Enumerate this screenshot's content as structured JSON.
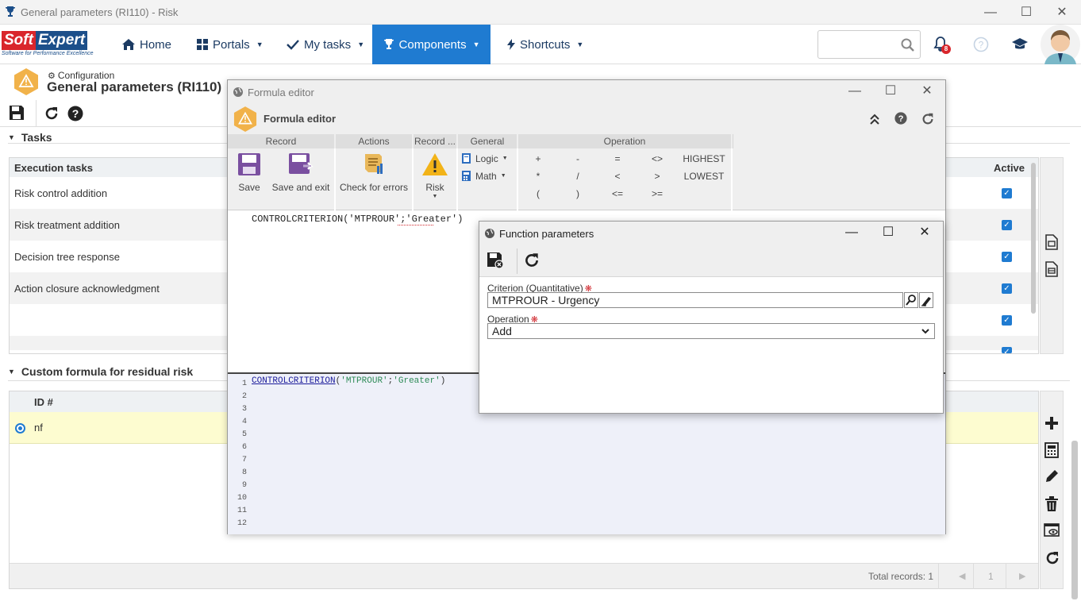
{
  "window": {
    "title": "General parameters (RI110) - Risk",
    "controls": [
      "minimize",
      "maximize",
      "close"
    ]
  },
  "brand": {
    "logo_text": "SoftExpert",
    "tagline": "Software for Performance Excellence"
  },
  "navbar": {
    "items": [
      {
        "label": "Home",
        "icon": "home-icon"
      },
      {
        "label": "Portals",
        "icon": "grid-icon",
        "dropdown": true
      },
      {
        "label": "My tasks",
        "icon": "check-icon",
        "dropdown": true
      },
      {
        "label": "Components",
        "icon": "trophy-icon",
        "dropdown": true,
        "active": true
      },
      {
        "label": "Shortcuts",
        "icon": "bolt-icon",
        "dropdown": true
      }
    ],
    "search_placeholder": "",
    "notifications_count": "8",
    "accent": "#1f7bd1"
  },
  "page": {
    "breadcrumb": "Configuration",
    "title": "General parameters (RI110)"
  },
  "tasks": {
    "section_title": "Tasks",
    "columns": [
      "Execution tasks",
      "Active"
    ],
    "rows": [
      {
        "name": "Risk control addition",
        "active": true
      },
      {
        "name": "Risk treatment addition",
        "active": true
      },
      {
        "name": "Decision tree response",
        "active": true
      },
      {
        "name": "Action closure acknowledgment",
        "active": true
      },
      {
        "name": "",
        "active": true
      },
      {
        "name": "",
        "active": true
      }
    ]
  },
  "custom_formula": {
    "section_title": "Custom formula for residual risk",
    "columns": [
      "ID #"
    ],
    "rows": [
      {
        "id": "nf",
        "selected": true
      }
    ],
    "total_records": "Total records: 1",
    "page_number": "1"
  },
  "formula_editor": {
    "window_title": "Formula editor",
    "header_title": "Formula editor",
    "ribbon": {
      "groups": [
        {
          "title": "Record",
          "buttons": [
            "Save",
            "Save and exit"
          ]
        },
        {
          "title": "Actions",
          "buttons": [
            "Check for errors"
          ]
        },
        {
          "title": "Record ...",
          "buttons": [
            "Risk"
          ]
        },
        {
          "title": "General",
          "buttons": [
            "Logic",
            "Math"
          ]
        },
        {
          "title": "Operation",
          "buttons": []
        }
      ],
      "operators": [
        [
          "+",
          "-",
          "=",
          "<>",
          "HIGHEST"
        ],
        [
          "*",
          "/",
          "<",
          ">",
          "LOWEST"
        ],
        [
          "(",
          ")",
          "<=",
          ">="
        ]
      ]
    },
    "preview_code": "CONTROLCRITERION('MTPROUR';'Greater')",
    "editor": {
      "fn": "CONTROLCRITERION",
      "open": "(",
      "arg1": "'MTPROUR'",
      "sep": ";",
      "arg2": "'Greater'",
      "close": ")",
      "line_numbers": [
        "1",
        "2",
        "3",
        "4",
        "5",
        "6",
        "7",
        "8",
        "9",
        "10",
        "11",
        "12"
      ]
    }
  },
  "function_parameters": {
    "title": "Function parameters",
    "criterion_label": "Criterion (Quantitative)",
    "criterion_value": "MTPROUR - Urgency",
    "operation_label": "Operation",
    "operation_value": "Add"
  }
}
